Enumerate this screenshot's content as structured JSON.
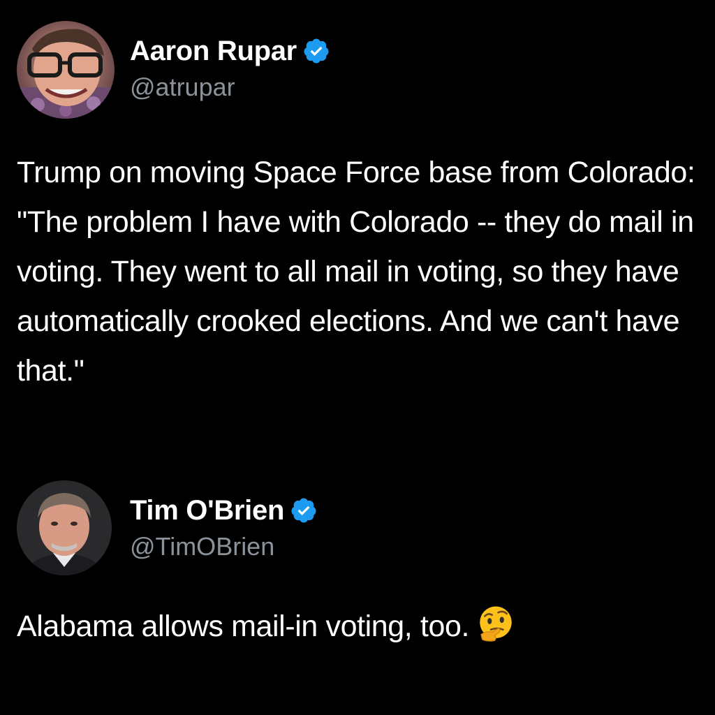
{
  "tweets": [
    {
      "author": {
        "display_name": "Aaron Rupar",
        "handle": "@atrupar",
        "verified": true,
        "avatar_icon": "avatar-photo"
      },
      "text": "Trump on moving Space Force base from Colorado: \"The problem I have with Colorado -- they do mail in voting. They went to all mail in voting, so they have automatically crooked elections. And we can't have that.\""
    },
    {
      "author": {
        "display_name": "Tim O'Brien",
        "handle": "@TimOBrien",
        "verified": true,
        "avatar_icon": "avatar-photo"
      },
      "text": "Alabama allows mail-in voting, too.",
      "trailing_emoji": "thinking-face-emoji"
    }
  ],
  "colors": {
    "background": "#000000",
    "text": "#ffffff",
    "handle": "#8b9299",
    "verified_badge": "#1d9bf0"
  }
}
